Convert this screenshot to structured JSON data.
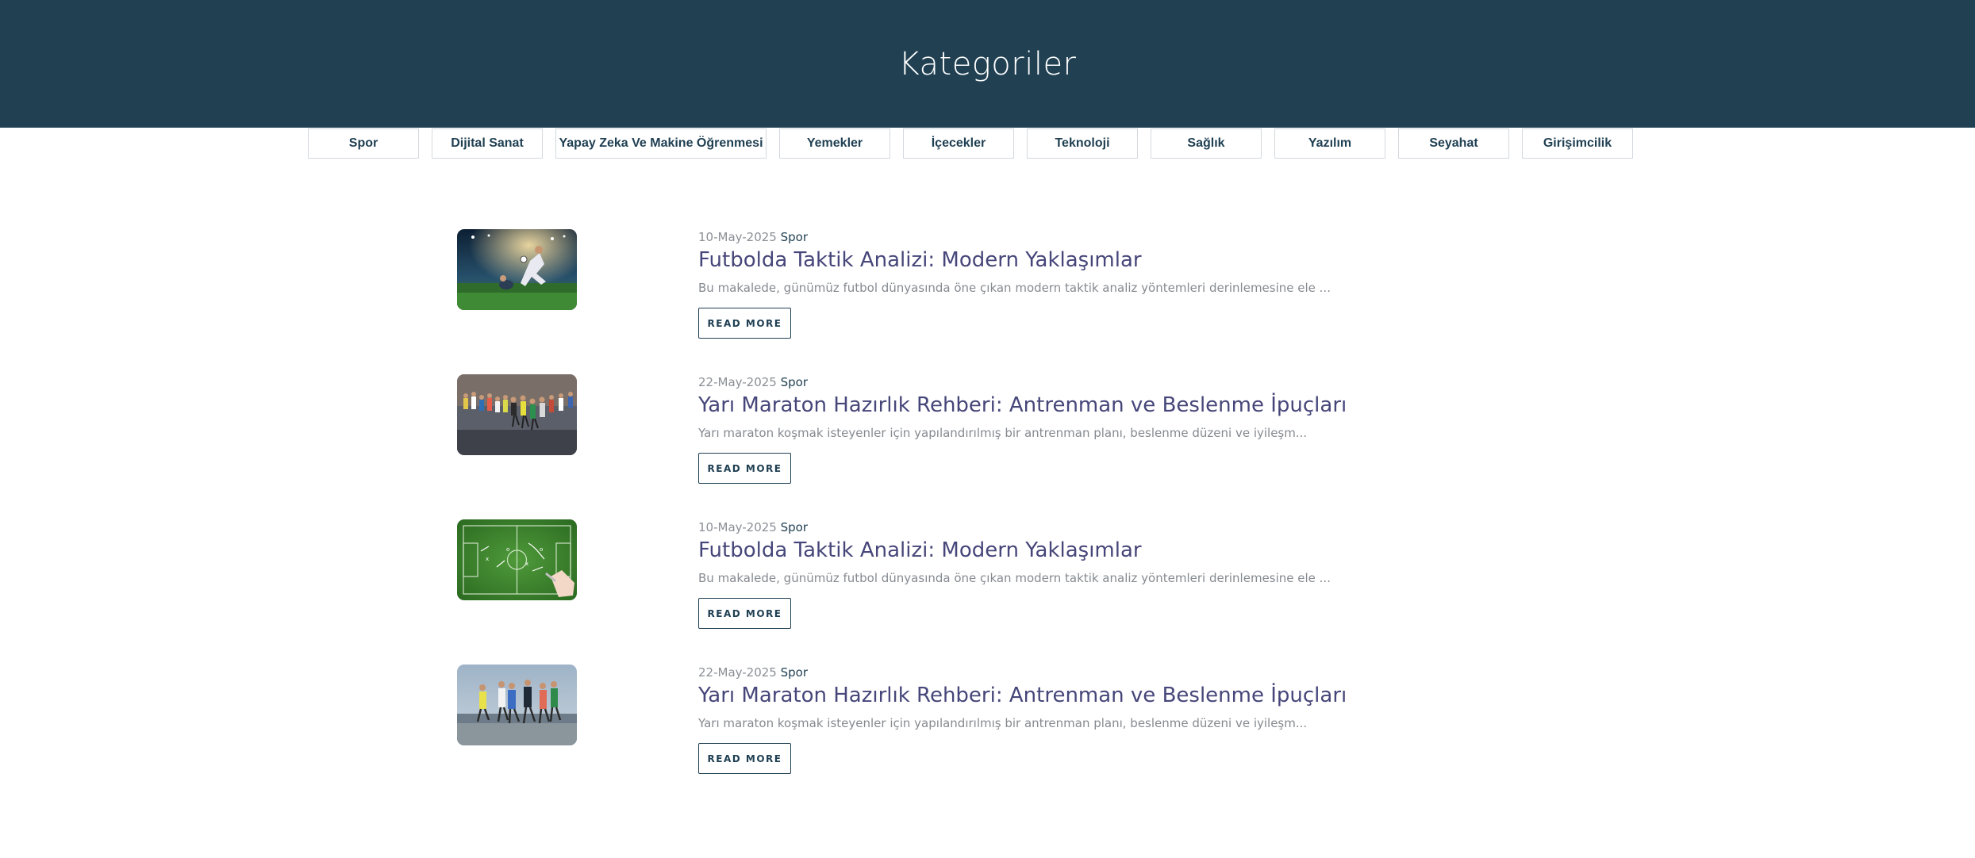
{
  "page": {
    "title": "Kategoriler"
  },
  "categories": [
    {
      "label": "Spor",
      "size": "std"
    },
    {
      "label": "Dijital Sanat",
      "size": "std"
    },
    {
      "label": "Yapay Zeka Ve Makine Öğrenmesi",
      "size": "wide"
    },
    {
      "label": "Yemekler",
      "size": "std"
    },
    {
      "label": "İçecekler",
      "size": "std"
    },
    {
      "label": "Teknoloji",
      "size": "std"
    },
    {
      "label": "Sağlık",
      "size": "std"
    },
    {
      "label": "Yazılım",
      "size": "std"
    },
    {
      "label": "Seyahat",
      "size": "std"
    },
    {
      "label": "Girişimcilik",
      "size": "std"
    }
  ],
  "posts": [
    {
      "date": "10-May-2025",
      "category": "Spor",
      "title": "Futbolda Taktik Analizi: Modern Yaklaşımlar",
      "excerpt": "Bu makalede, günümüz futbol dünyasında öne çıkan modern taktik analiz yöntemleri derinlemesine ele ...",
      "button": "READ MORE",
      "image": "football-stadium-kick"
    },
    {
      "date": "22-May-2025",
      "category": "Spor",
      "title": "Yarı Maraton Hazırlık Rehberi: Antrenman ve Beslenme İpuçları",
      "excerpt": "Yarı maraton koşmak isteyenler için yapılandırılmış bir antrenman planı, beslenme düzeni ve iyileşm...",
      "button": "READ MORE",
      "image": "marathon-crowd"
    },
    {
      "date": "10-May-2025",
      "category": "Spor",
      "title": "Futbolda Taktik Analizi: Modern Yaklaşımlar",
      "excerpt": "Bu makalede, günümüz futbol dünyasında öne çıkan modern taktik analiz yöntemleri derinlemesine ele ...",
      "button": "READ MORE",
      "image": "tactics-board"
    },
    {
      "date": "22-May-2025",
      "category": "Spor",
      "title": "Yarı Maraton Hazırlık Rehberi: Antrenman ve Beslenme İpuçları",
      "excerpt": "Yarı maraton koşmak isteyenler için yapılandırılmış bir antrenman planı, beslenme düzeni ve iyileşm...",
      "button": "READ MORE",
      "image": "runners-group"
    }
  ]
}
